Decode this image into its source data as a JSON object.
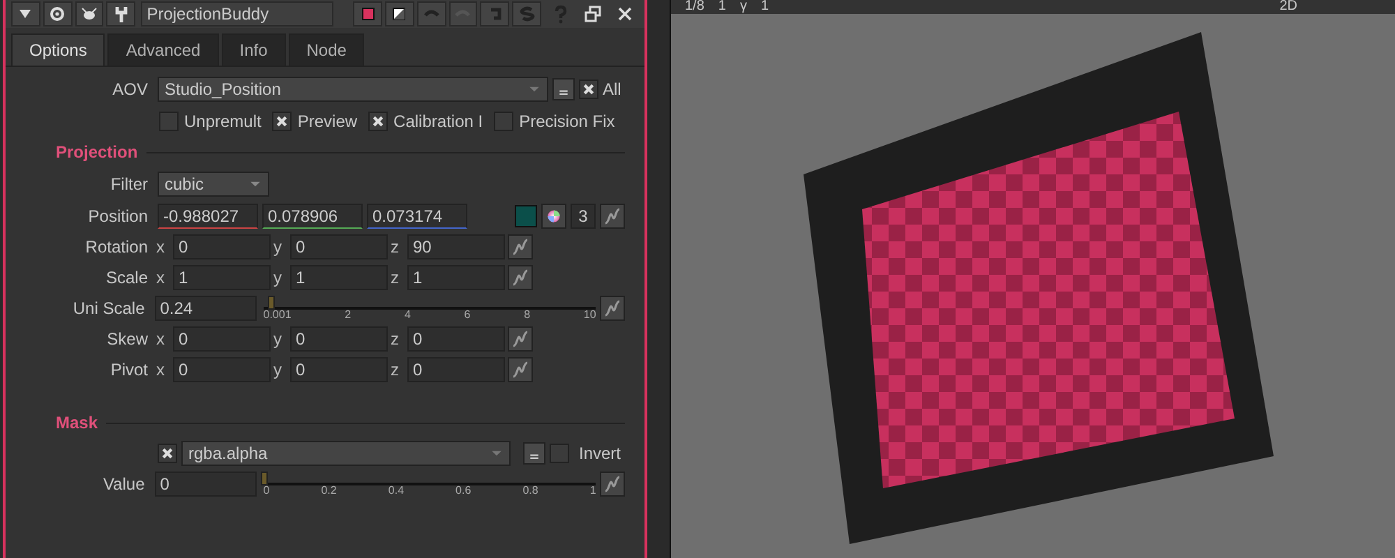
{
  "node_name": "ProjectionBuddy",
  "tabs": [
    {
      "label": "Options",
      "selected": true
    },
    {
      "label": "Advanced",
      "selected": false
    },
    {
      "label": "Info",
      "selected": false
    },
    {
      "label": "Node",
      "selected": false
    }
  ],
  "aov": {
    "label": "AOV",
    "value": "Studio_Position",
    "all_label": "All",
    "all_checked": true
  },
  "options": [
    {
      "label": "Unpremult",
      "checked": false
    },
    {
      "label": "Preview",
      "checked": true
    },
    {
      "label": "Calibration I",
      "checked": true
    },
    {
      "label": "Precision Fix",
      "checked": false
    }
  ],
  "projection": {
    "title": "Projection",
    "filter": {
      "label": "Filter",
      "value": "cubic"
    },
    "position": {
      "label": "Position",
      "values": [
        "-0.988027",
        "0.078906",
        "0.073174"
      ],
      "color": "#0b4f4a",
      "count": "3"
    },
    "rows": [
      {
        "kind": "xyz",
        "label": "Rotation",
        "fields": [
          {
            "axis": "x",
            "value": "0"
          },
          {
            "axis": "y",
            "value": "0"
          },
          {
            "axis": "z",
            "value": "90"
          }
        ]
      },
      {
        "kind": "xyz",
        "label": "Scale",
        "fields": [
          {
            "axis": "x",
            "value": "1"
          },
          {
            "axis": "y",
            "value": "1"
          },
          {
            "axis": "z",
            "value": "1"
          }
        ]
      },
      {
        "kind": "slider",
        "label": "Uni Scale",
        "value": "0.24",
        "level": 0.024,
        "ticks": [
          "0.001",
          "2",
          "4",
          "6",
          "8",
          "10"
        ]
      },
      {
        "kind": "xyz",
        "label": "Skew",
        "fields": [
          {
            "axis": "x",
            "value": "0"
          },
          {
            "axis": "y",
            "value": "0"
          },
          {
            "axis": "z",
            "value": "0"
          }
        ]
      },
      {
        "kind": "xyz",
        "label": "Pivot",
        "fields": [
          {
            "axis": "x",
            "value": "0"
          },
          {
            "axis": "y",
            "value": "0"
          },
          {
            "axis": "z",
            "value": "0"
          }
        ]
      }
    ]
  },
  "mask": {
    "title": "Mask",
    "enabled": true,
    "channel": "rgba.alpha",
    "invert_label": "Invert",
    "invert": false,
    "value": {
      "label": "Value",
      "value": "0",
      "level": 0,
      "ticks": [
        "0",
        "0.2",
        "0.4",
        "0.6",
        "0.8",
        "1"
      ]
    }
  },
  "viewer": {
    "frame": "1/8",
    "gain": "1",
    "gamma_label": "γ",
    "gamma": "1",
    "view_mode": "2D"
  }
}
